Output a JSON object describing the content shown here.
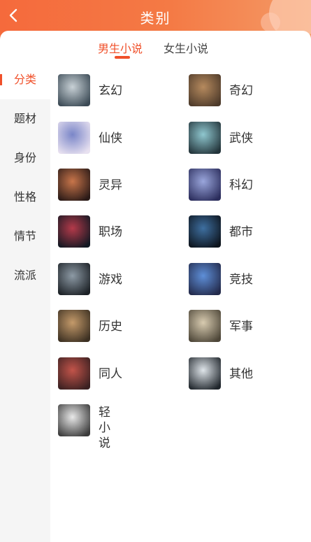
{
  "header": {
    "title": "类别",
    "back_icon": "chevron-left-icon"
  },
  "tabs": [
    {
      "label": "男生小说",
      "active": true
    },
    {
      "label": "女生小说",
      "active": false
    }
  ],
  "sidebar": {
    "items": [
      {
        "label": "分类",
        "active": true
      },
      {
        "label": "题材",
        "active": false
      },
      {
        "label": "身份",
        "active": false
      },
      {
        "label": "性格",
        "active": false
      },
      {
        "label": "情节",
        "active": false
      },
      {
        "label": "流派",
        "active": false
      }
    ]
  },
  "categories": [
    {
      "label": "玄幻",
      "colors": [
        "#c8d1d6",
        "#3b4a55"
      ]
    },
    {
      "label": "奇幻",
      "colors": [
        "#b68a5e",
        "#4d3a2a"
      ]
    },
    {
      "label": "仙侠",
      "colors": [
        "#7a86c8",
        "#e8e1f0"
      ]
    },
    {
      "label": "武侠",
      "colors": [
        "#8fc7cf",
        "#23343a"
      ]
    },
    {
      "label": "灵异",
      "colors": [
        "#c8754a",
        "#2a1a17"
      ]
    },
    {
      "label": "科幻",
      "colors": [
        "#9aa6dc",
        "#2b2d5c"
      ]
    },
    {
      "label": "职场",
      "colors": [
        "#b43a4a",
        "#121822"
      ]
    },
    {
      "label": "都市",
      "colors": [
        "#3e6fa0",
        "#0d141d"
      ]
    },
    {
      "label": "游戏",
      "colors": [
        "#8d9aa5",
        "#1c2126"
      ]
    },
    {
      "label": "竞技",
      "colors": [
        "#5e8fd8",
        "#232a4b"
      ]
    },
    {
      "label": "历史",
      "colors": [
        "#c49a6a",
        "#3c3022"
      ]
    },
    {
      "label": "军事",
      "colors": [
        "#d8cbb0",
        "#4d4638"
      ]
    },
    {
      "label": "同人",
      "colors": [
        "#c2544a",
        "#3a2021"
      ]
    },
    {
      "label": "其他",
      "colors": [
        "#dfe5ea",
        "#20262c"
      ]
    },
    {
      "label": "轻小说",
      "colors": [
        "#e9e9e9",
        "#3a3a3a"
      ]
    }
  ]
}
